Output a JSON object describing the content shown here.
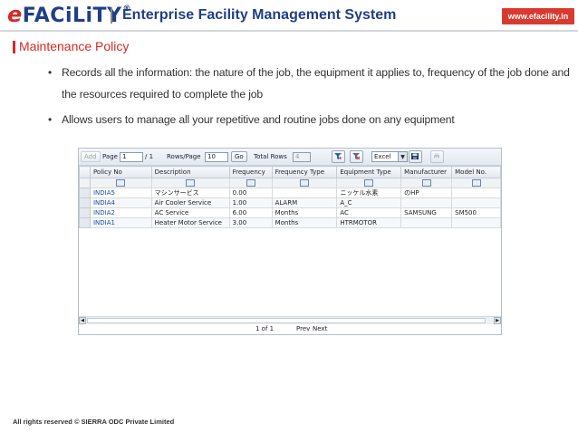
{
  "header": {
    "logo_e": "e",
    "logo_rest": "FACiLiTY",
    "logo_reg": "®",
    "system_title": "Enterprise Facility Management System",
    "site": "www.efacility.in"
  },
  "section_title": "Maintenance Policy",
  "bullets": [
    "Records all the information: the nature of the job, the equipment it applies to, frequency of the job done and",
    "the resources required to complete the job",
    "Allows users to manage all your repetitive and routine jobs done on any equipment"
  ],
  "toolbar": {
    "add_label": "Add",
    "page_label": "Page",
    "page_value": "1",
    "page_total": "/ 1",
    "rows_label": "Rows/Page",
    "rows_value": "10",
    "go_label": "Go",
    "total_rows_label": "Total Rows",
    "total_rows_value": "4",
    "export_format": "Excel"
  },
  "table": {
    "columns": [
      "Policy No",
      "Description",
      "Frequency",
      "Frequency Type",
      "Equipment Type",
      "Manufacturer",
      "Model No."
    ],
    "rows": [
      [
        "INDIA5",
        "マシンサービス",
        "0.00",
        "",
        "ニッケル水素",
        "のHP",
        ""
      ],
      [
        "INDIA4",
        "Air Cooler Service",
        "1.00",
        "ALARM",
        "A_C",
        "",
        ""
      ],
      [
        "INDIA2",
        "AC Service",
        "6.00",
        "Months",
        "AC",
        "SAMSUNG",
        "SM500"
      ],
      [
        "INDIA1",
        "Heater Motor Service",
        "3.00",
        "Months",
        "HTRMOTOR",
        "",
        ""
      ]
    ]
  },
  "pager": {
    "page_info": "1 of 1",
    "prev_label": "Prev",
    "next_label": "Next"
  },
  "footer": "All rights reserved © SIERRA ODC Private Limited",
  "colors": {
    "brand_red": "#d62a26",
    "brand_blue": "#1f3f86",
    "link_blue": "#1a4fa0"
  }
}
